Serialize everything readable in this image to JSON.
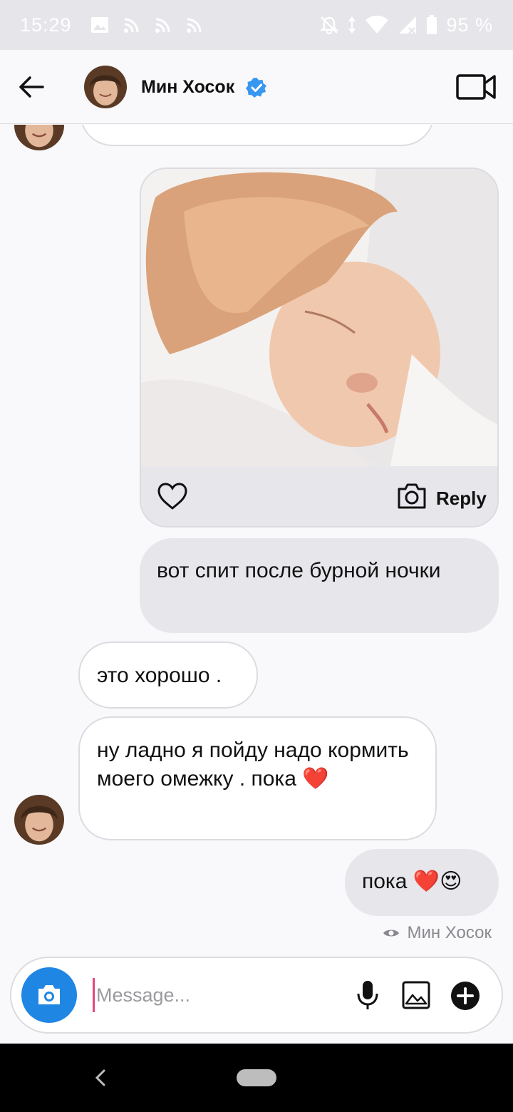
{
  "status_bar": {
    "time": "15:29",
    "battery": "95 %",
    "icons_left": [
      "image-icon",
      "cast-icon",
      "cast-icon",
      "cast-icon"
    ],
    "icons_right": [
      "notifications-off-icon",
      "data-arrows-icon",
      "wifi-icon",
      "signal-icon",
      "battery-icon"
    ]
  },
  "header": {
    "contact_name": "Мин Хосок",
    "verified": true,
    "accent_color": "#3897f0"
  },
  "messages": [
    {
      "from": "them",
      "type": "text",
      "text": ""
    },
    {
      "from": "me",
      "type": "photo",
      "reply_label": "Reply"
    },
    {
      "from": "me",
      "type": "text",
      "text": "вот спит после бурной ночки"
    },
    {
      "from": "them",
      "type": "text",
      "text": "это хорошо ."
    },
    {
      "from": "them",
      "type": "text",
      "text": "ну ладно я пойду надо кормить моего омежку . пока",
      "emoji": "❤️"
    },
    {
      "from": "me",
      "type": "text",
      "text": "пока",
      "emoji": "❤️😍"
    }
  ],
  "seen_by": "Мин Хосок",
  "composer": {
    "placeholder": "Message...",
    "camera_color": "#1f86e3"
  }
}
